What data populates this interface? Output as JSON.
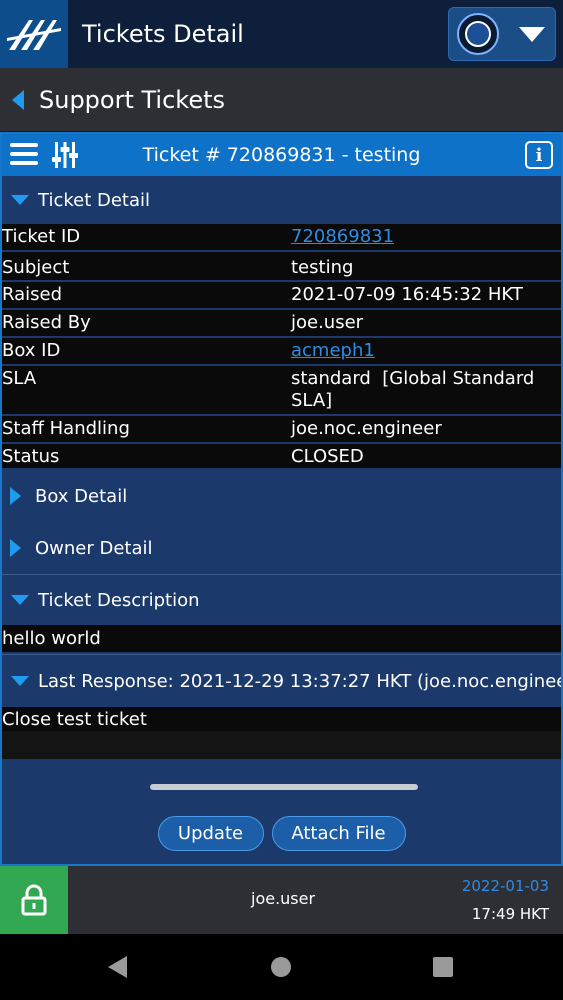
{
  "appbar": {
    "title": "Tickets Detail"
  },
  "backbar": {
    "label": "Support Tickets"
  },
  "toolbar": {
    "title": "Ticket # 720869831 - testing"
  },
  "sections": {
    "ticket_detail": "Ticket Detail",
    "box_detail": "Box Detail",
    "owner_detail": "Owner Detail",
    "ticket_description": "Ticket Description",
    "last_response": "Last Response: 2021-12-29 13:37:27 HKT (joe.noc.enginee..."
  },
  "detail": {
    "ticket_id_label": "Ticket ID",
    "ticket_id_value": "720869831",
    "subject_label": "Subject",
    "subject_value": "testing",
    "raised_label": "Raised",
    "raised_value": "2021-07-09 16:45:32 HKT",
    "raised_by_label": "Raised By",
    "raised_by_value": "joe.user",
    "box_id_label": "Box ID",
    "box_id_value": "acmeph1",
    "sla_label": "SLA",
    "sla_value": "standard  [Global Standard SLA]",
    "staff_label": "Staff Handling",
    "staff_value": "joe.noc.engineer",
    "status_label": "Status",
    "status_value": "CLOSED"
  },
  "description": {
    "text": "hello world"
  },
  "response": {
    "text": "Close test ticket"
  },
  "buttons": {
    "update": "Update",
    "attach": "Attach File"
  },
  "statusbar": {
    "user": "joe.user",
    "date": "2022-01-03",
    "time": "17:49 HKT"
  },
  "icons": {
    "logo": "brand-logo-icon",
    "avatar": "account-avatar-icon",
    "menu": "hamburger-menu-icon",
    "filter": "sliders-filter-icon",
    "info": "info-icon",
    "lock": "lock-icon"
  },
  "colors": {
    "accent": "#1e9cf0",
    "panel": "#1b3a6b",
    "toolbar": "#0e73c8",
    "lock": "#32a852",
    "link": "#2d8ce6"
  }
}
